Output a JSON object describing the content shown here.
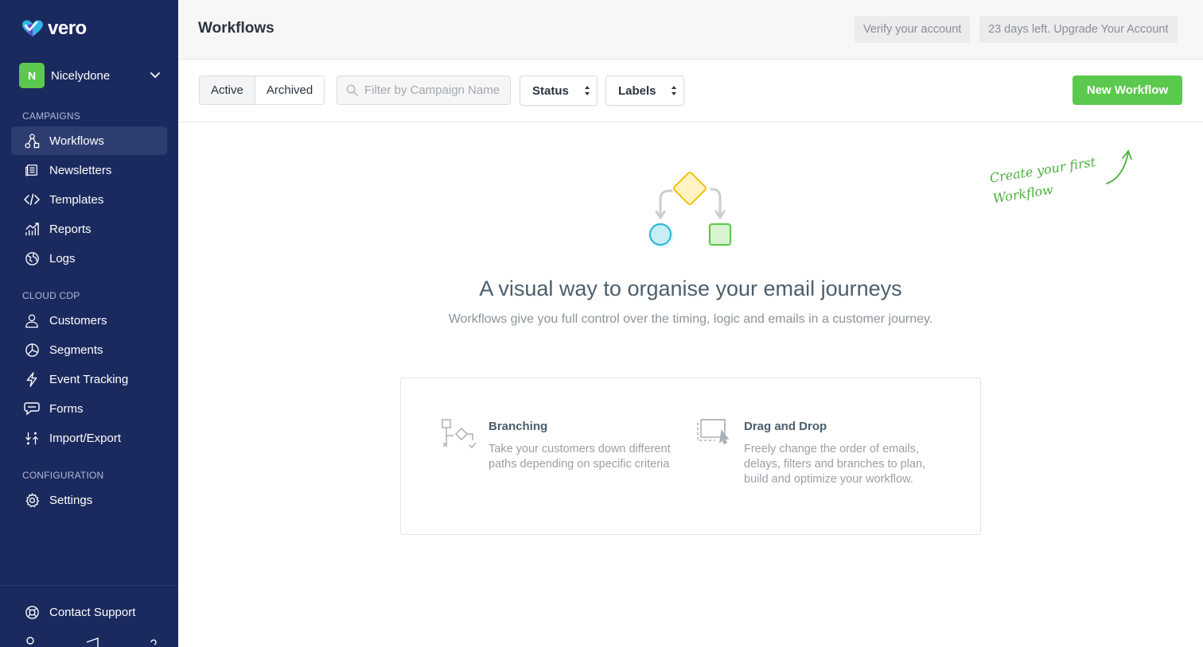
{
  "brand": {
    "name": "vero",
    "accent": "#5bc84e",
    "sidebar_bg": "#1b2a5e"
  },
  "account": {
    "initial": "N",
    "name": "Nicelydone"
  },
  "sidebar": {
    "sections": [
      {
        "label": "CAMPAIGNS",
        "items": [
          {
            "label": "Workflows",
            "icon": "workflow-icon",
            "active": true
          },
          {
            "label": "Newsletters",
            "icon": "newsletter-icon"
          },
          {
            "label": "Templates",
            "icon": "code-icon"
          },
          {
            "label": "Reports",
            "icon": "chart-icon"
          },
          {
            "label": "Logs",
            "icon": "globe-icon"
          }
        ]
      },
      {
        "label": "CLOUD CDP",
        "items": [
          {
            "label": "Customers",
            "icon": "user-icon"
          },
          {
            "label": "Segments",
            "icon": "pie-icon"
          },
          {
            "label": "Event Tracking",
            "icon": "bolt-icon"
          },
          {
            "label": "Forms",
            "icon": "form-icon"
          },
          {
            "label": "Import/Export",
            "icon": "import-export-icon"
          }
        ]
      },
      {
        "label": "CONFIGURATION",
        "items": [
          {
            "label": "Settings",
            "icon": "gear-icon"
          }
        ]
      }
    ],
    "footer": {
      "label": "Contact Support",
      "icon": "lifebuoy-icon"
    }
  },
  "header": {
    "title": "Workflows",
    "verify_label": "Verify your account",
    "upgrade_label": "23 days left. Upgrade Your Account"
  },
  "filters": {
    "tabs": [
      "Active",
      "Archived"
    ],
    "active_tab": "Active",
    "search_placeholder": "Filter by Campaign Name",
    "status_label": "Status",
    "labels_label": "Labels",
    "new_button": "New Workflow"
  },
  "empty_state": {
    "hint_line1": "Create your first",
    "hint_line2": "Workflow",
    "headline": "A visual way to organise your email journeys",
    "subhead": "Workflows give you full control over the timing, logic and emails in a customer journey.",
    "features": [
      {
        "title": "Branching",
        "desc_line1": "Take your customers down different",
        "desc_line2": "paths depending on specific criteria",
        "desc_line3": "",
        "icon": "branching-icon"
      },
      {
        "title": "Drag and Drop",
        "desc_line1": "Freely change the order of emails,",
        "desc_line2": "delays, filters and branches to plan,",
        "desc_line3": "build and optimize your workflow.",
        "icon": "drag-drop-icon"
      }
    ]
  }
}
